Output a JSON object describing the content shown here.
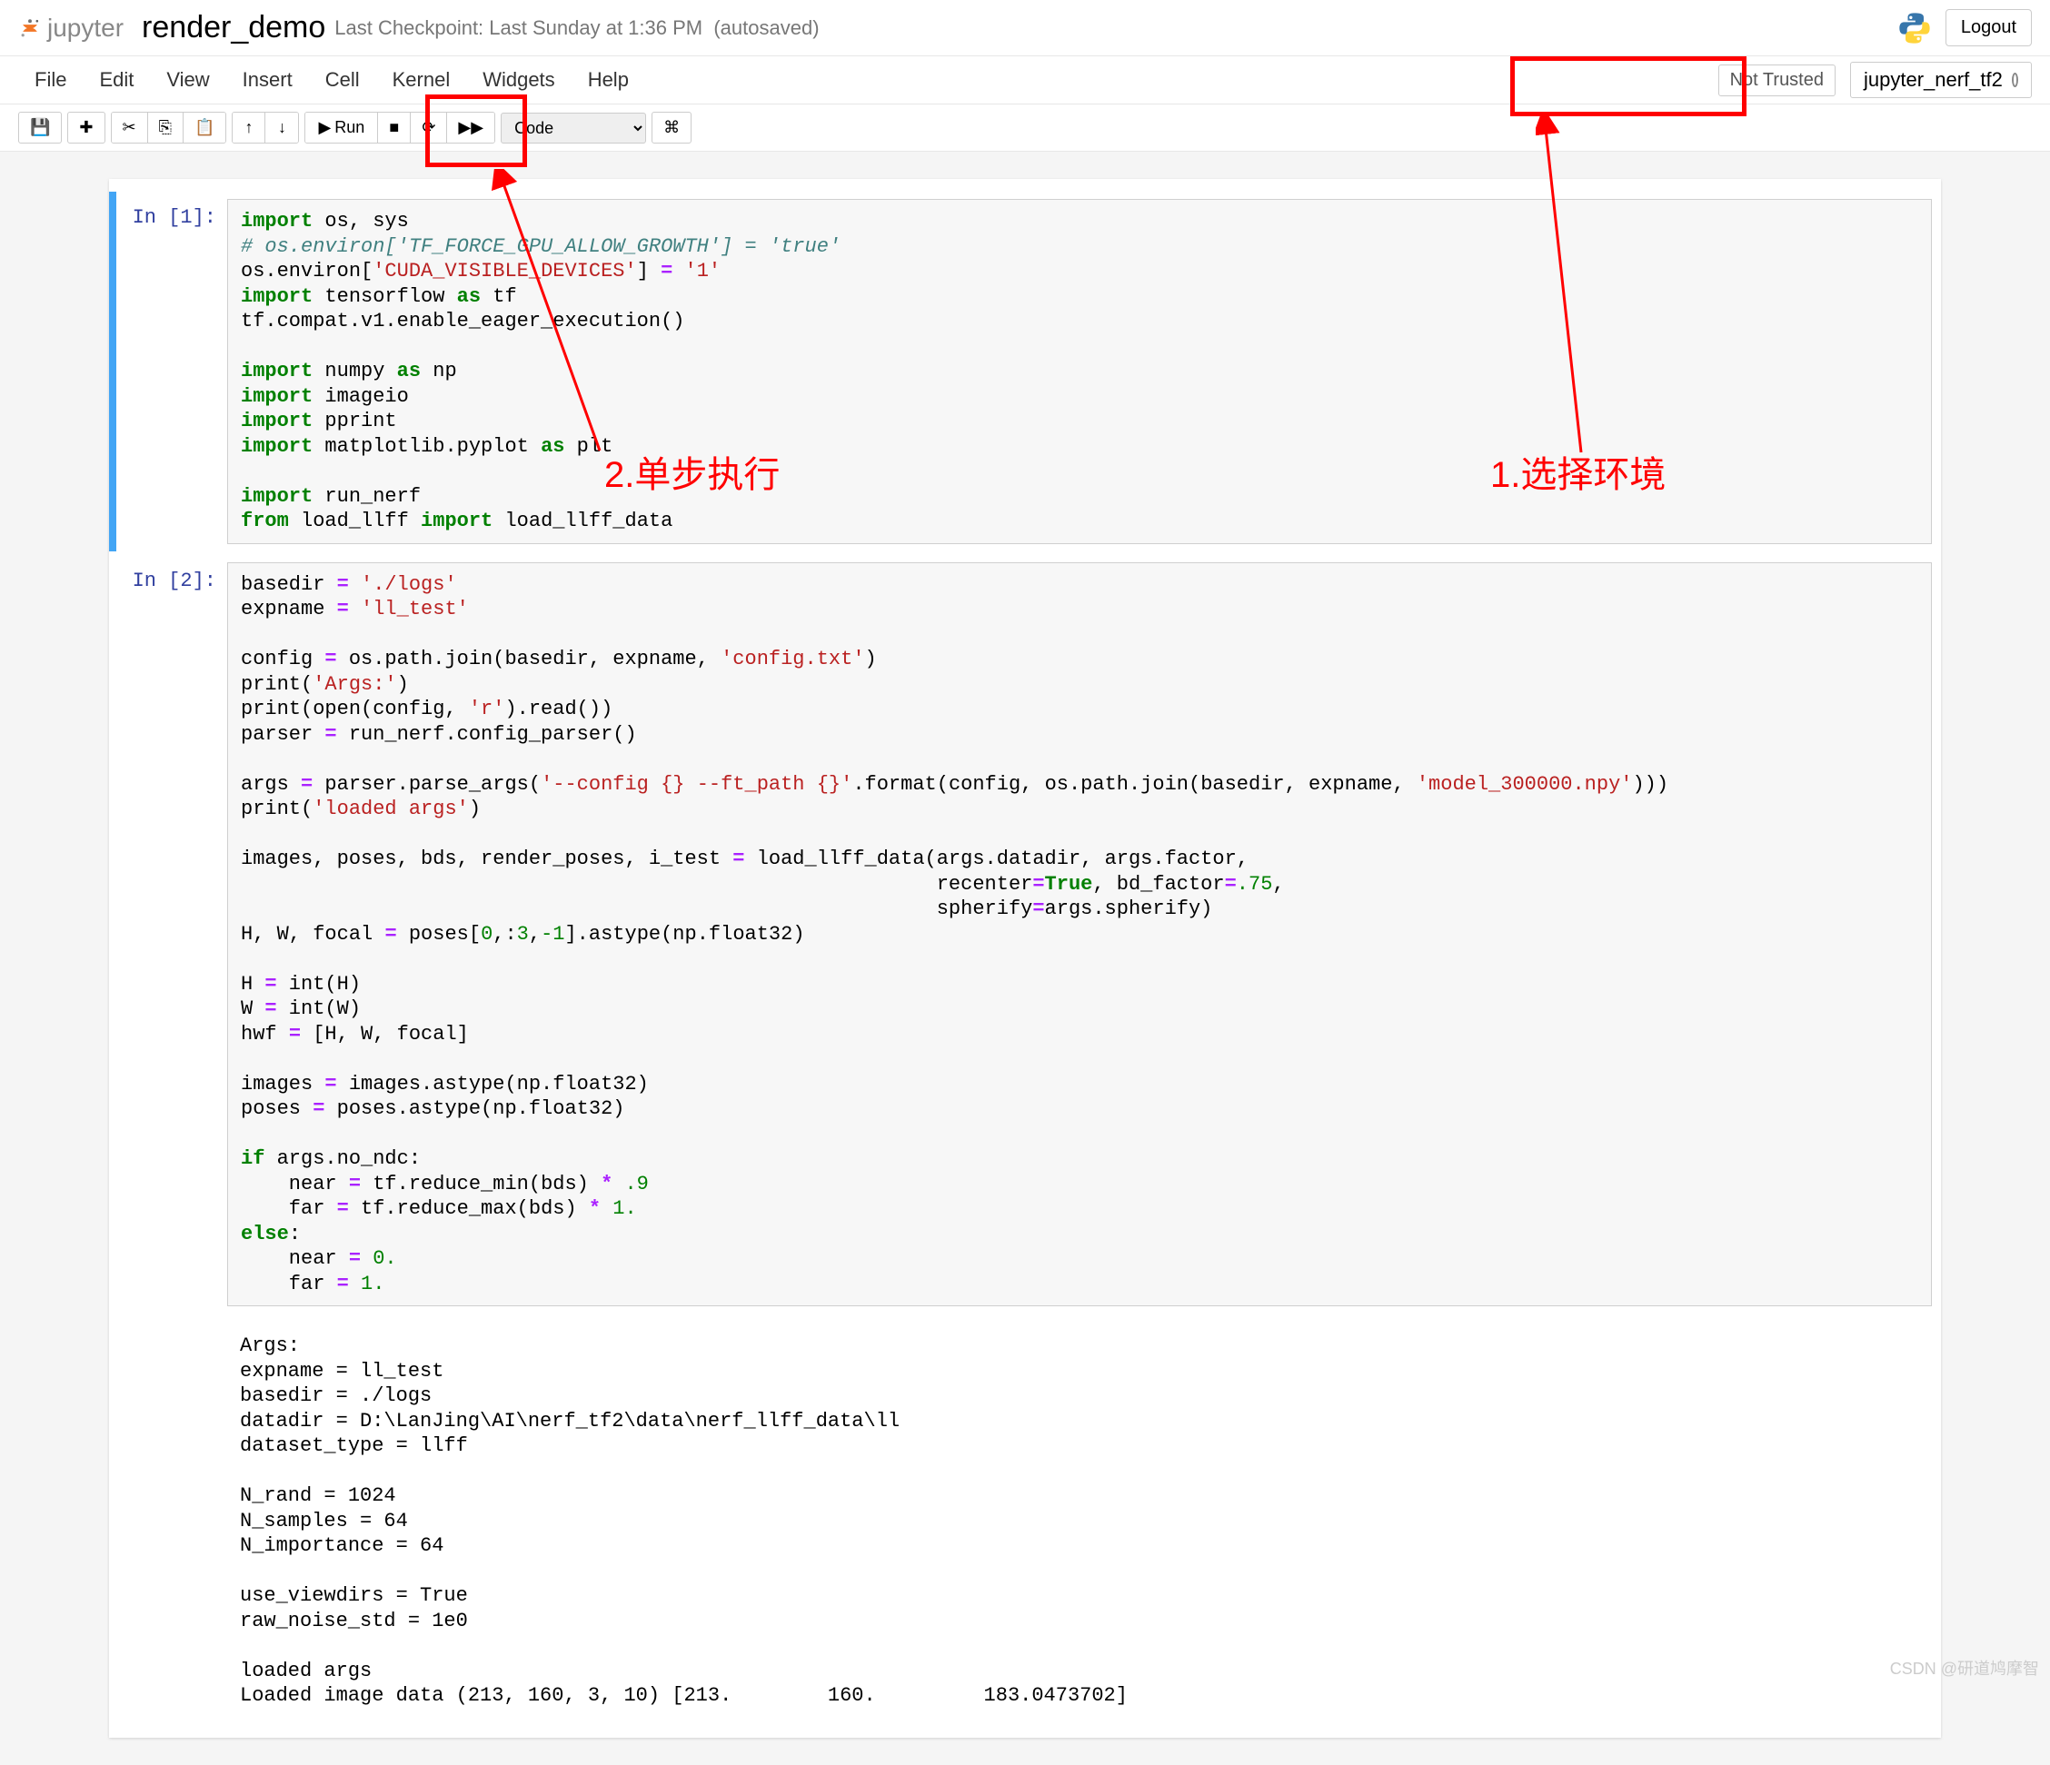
{
  "header": {
    "brand": "jupyter",
    "notebook_name": "render_demo",
    "checkpoint": "Last Checkpoint: Last Sunday at 1:36 PM",
    "autosave": "(autosaved)",
    "logout": "Logout"
  },
  "menu": {
    "items": [
      "File",
      "Edit",
      "View",
      "Insert",
      "Cell",
      "Kernel",
      "Widgets",
      "Help"
    ],
    "not_trusted": "Not Trusted",
    "kernel_name": "jupyter_nerf_tf2"
  },
  "toolbar": {
    "save_icon": "💾",
    "add_icon": "✚",
    "cut_icon": "✂",
    "copy_icon": "⎘",
    "paste_icon": "📋",
    "up_icon": "↑",
    "down_icon": "↓",
    "run_icon": "▶",
    "run_label": "Run",
    "stop_icon": "■",
    "restart_icon": "⟳",
    "ff_icon": "▶▶",
    "cell_type": "Code",
    "cmd_icon": "⌘"
  },
  "cells": [
    {
      "prompt": "In  [1]:",
      "code_html": "<span class='kw'>import</span> os, sys\n<span class='cm'># os.environ['TF_FORCE_GPU_ALLOW_GROWTH'] = 'true'</span>\nos.environ[<span class='st'>'CUDA_VISIBLE_DEVICES'</span>] <span class='op'>=</span> <span class='st'>'1'</span>\n<span class='kw'>import</span> tensorflow <span class='kw'>as</span> tf\ntf.compat.v1.enable_eager_execution()\n\n<span class='kw'>import</span> numpy <span class='kw'>as</span> np\n<span class='kw'>import</span> imageio\n<span class='kw'>import</span> pprint\n<span class='kw'>import</span> matplotlib.pyplot <span class='kw'>as</span> plt\n\n<span class='kw'>import</span> run_nerf\n<span class='kw'>from</span> load_llff <span class='kw'>import</span> load_llff_data"
    },
    {
      "prompt": "In  [2]:",
      "code_html": "basedir <span class='op'>=</span> <span class='st'>'./logs'</span>\nexpname <span class='op'>=</span> <span class='st'>'ll_test'</span>\n\nconfig <span class='op'>=</span> os.path.join(basedir, expname, <span class='st'>'config.txt'</span>)\nprint(<span class='st'>'Args:'</span>)\nprint(open(config, <span class='st'>'r'</span>).read())\nparser <span class='op'>=</span> run_nerf.config_parser()\n\nargs <span class='op'>=</span> parser.parse_args(<span class='st'>'--config {} --ft_path {}'</span>.format(config, os.path.join(basedir, expname, <span class='st'>'model_300000.npy'</span>)))\nprint(<span class='st'>'loaded args'</span>)\n\nimages, poses, bds, render_poses, i_test <span class='op'>=</span> load_llff_data(args.datadir, args.factor,\n                                                          recenter<span class='op'>=</span><span class='kw'>True</span>, bd_factor<span class='op'>=</span><span class='num'>.75</span>,\n                                                          spherify<span class='op'>=</span>args.spherify)\nH, W, focal <span class='op'>=</span> poses[<span class='num'>0</span>,:<span class='num'>3</span>,<span class='num'>-1</span>].astype(np.float32)\n\nH <span class='op'>=</span> int(H)\nW <span class='op'>=</span> int(W)\nhwf <span class='op'>=</span> [H, W, focal]\n\nimages <span class='op'>=</span> images.astype(np.float32)\nposes <span class='op'>=</span> poses.astype(np.float32)\n\n<span class='kw'>if</span> args.no_ndc:\n    near <span class='op'>=</span> tf.reduce_min(bds) <span class='op'>*</span> <span class='num'>.9</span>\n    far <span class='op'>=</span> tf.reduce_max(bds) <span class='op'>*</span> <span class='num'>1.</span>\n<span class='kw'>else</span>:\n    near <span class='op'>=</span> <span class='num'>0.</span>\n    far <span class='op'>=</span> <span class='num'>1.</span>",
      "output": "Args:\nexpname = ll_test\nbasedir = ./logs\ndatadir = D:\\LanJing\\AI\\nerf_tf2\\data\\nerf_llff_data\\ll\ndataset_type = llff\n\nN_rand = 1024\nN_samples = 64\nN_importance = 64\n\nuse_viewdirs = True\nraw_noise_std = 1e0\n\nloaded args\nLoaded image data (213, 160, 3, 10) [213.        160.         183.0473702]"
    }
  ],
  "annotations": {
    "a1": "1.选择环境",
    "a2": "2.单步执行"
  },
  "watermark": "CSDN @研道鸠摩智"
}
